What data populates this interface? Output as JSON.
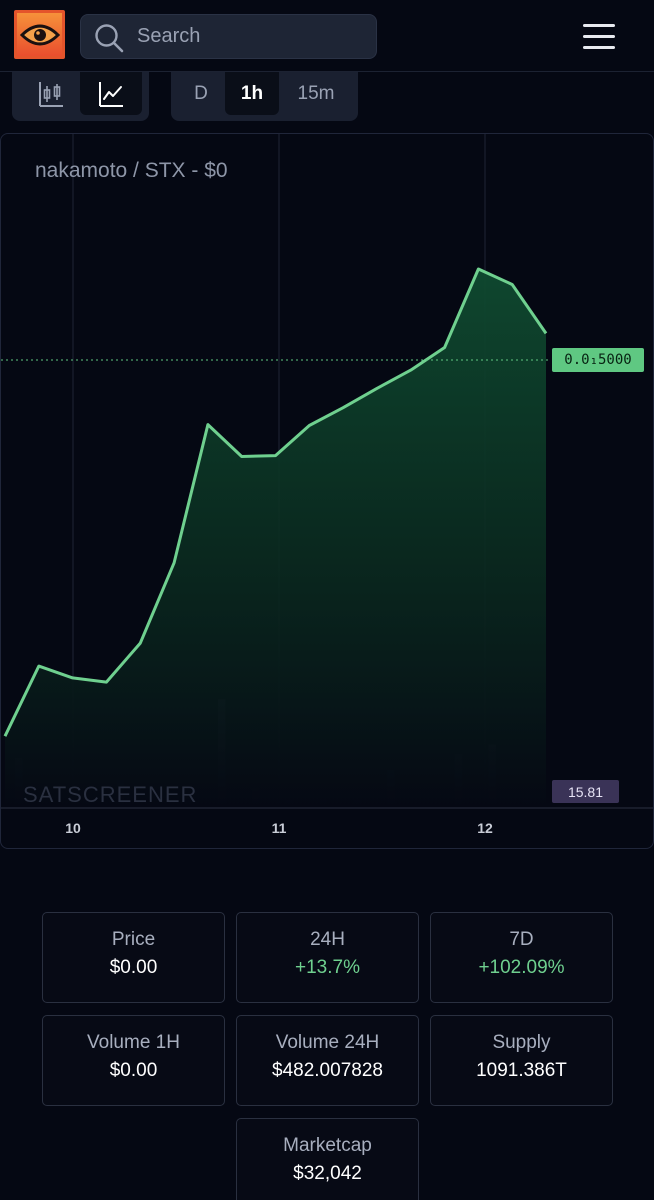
{
  "header": {
    "logo_icon": "eye-icon",
    "search": {
      "placeholder": "Search",
      "value": ""
    },
    "menu_icon": "hamburger-menu-icon"
  },
  "chart_type_toggle": {
    "options": [
      {
        "icon": "candlestick-chart-icon",
        "active": false
      },
      {
        "icon": "line-chart-icon",
        "active": true
      }
    ]
  },
  "timeframe_toggle": {
    "options": [
      {
        "label": "D",
        "active": false
      },
      {
        "label": "1h",
        "active": true
      },
      {
        "label": "15m",
        "active": false
      }
    ]
  },
  "chart": {
    "title": "nakamoto / STX - $0",
    "watermark": "SATSCREENER",
    "current_price_label": "0.0₁5000",
    "current_volume_label": "15.81",
    "x_ticks": [
      "10",
      "11",
      "12"
    ],
    "colors": {
      "line": "#6fd08f",
      "fill_top": "#0f4a30",
      "volume": "#3a3357",
      "price_tag": "#5fc882"
    }
  },
  "chart_data": {
    "type": "area",
    "x_ticks": [
      "10",
      "11",
      "12"
    ],
    "price_series": [
      0.6,
      15.5,
      13.0,
      12.1,
      20.4,
      37.5,
      66.9,
      60.1,
      60.3,
      66.7,
      70.5,
      74.6,
      78.5,
      83.3,
      100,
      96.7,
      86.3
    ],
    "volume_series": [
      23.7,
      0,
      4.5,
      13.4,
      2.1,
      6.0,
      51.8,
      9.4,
      3.6,
      4.2,
      3.6,
      18.0,
      0,
      25.6,
      30.3,
      3.7
    ],
    "current_price": "0.0₁5000",
    "current_volume": 15.81
  },
  "stats": [
    {
      "label": "Price",
      "value": "$0.00",
      "trend": "neutral"
    },
    {
      "label": "24H",
      "value": "+13.7%",
      "trend": "up"
    },
    {
      "label": "7D",
      "value": "+102.09%",
      "trend": "up"
    },
    {
      "label": "Volume 1H",
      "value": "$0.00",
      "trend": "neutral"
    },
    {
      "label": "Volume 24H",
      "value": "$482.007828",
      "trend": "neutral"
    },
    {
      "label": "Supply",
      "value": "1091.386T",
      "trend": "neutral"
    },
    {
      "label": "Marketcap",
      "value": "$32,042",
      "trend": "neutral"
    }
  ]
}
